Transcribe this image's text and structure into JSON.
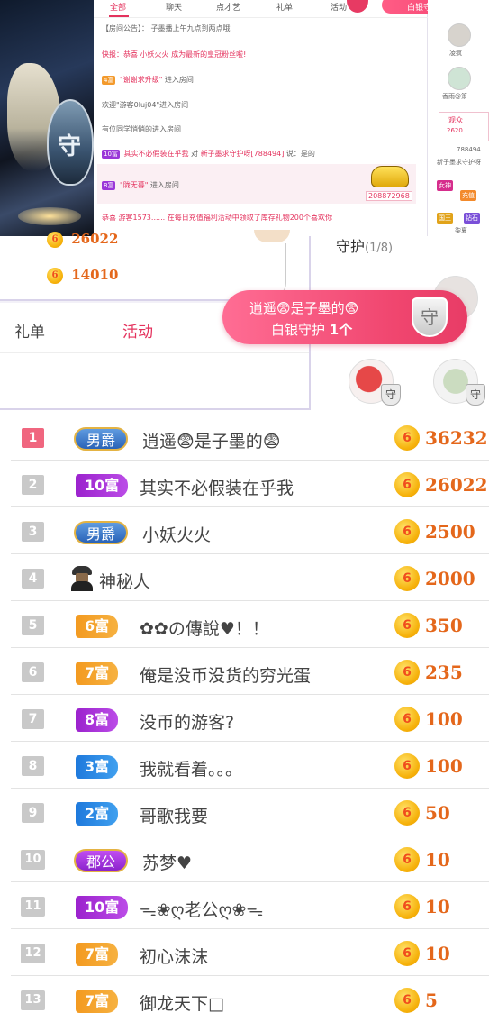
{
  "colors": {
    "accent": "#e4325d",
    "coin_text": "#e4671b",
    "guard_pink": "#f0466f"
  },
  "chat_window": {
    "tabs": [
      "全部",
      "聊天",
      "点才艺",
      "礼单",
      "活动"
    ],
    "guard_pill_label": "白银守护 1个",
    "messages": [
      {
        "prefix": "【房间公告】：",
        "text": "子墨播上午九点到两点哦"
      },
      {
        "prefix": "快报：恭喜",
        "text": "小妖火火 成为最新的皇冠粉丝啦!"
      },
      {
        "level": "4富",
        "name": "\"谢谢求升级\"",
        "text": "进入房间"
      },
      {
        "text": "欢迎\"游客0luj04\"进入房间"
      },
      {
        "text": "有位同学悄悄的进入房间"
      },
      {
        "level": "10富",
        "name": "其实不必假装在乎我",
        "mid": "对",
        "target": "新子墨求守护呀[788494]",
        "text": "说：是的"
      },
      {
        "level": "8富",
        "name": "\"陇无暮\"",
        "text": "进入房间"
      },
      {
        "text": "恭喜 游客1573...... 在每日充值福利活动中领取了库存礼物200个喜欢你"
      }
    ],
    "gift_number": "208872968"
  },
  "side_panel": {
    "users": [
      "凌疯",
      "香雨@箫"
    ],
    "tab_label": "观众",
    "tab_count": "2620",
    "viewer_id": "788494",
    "viewer_name": "新子墨求守护呀",
    "badges": [
      "女神",
      "充值",
      "国王",
      "钻石",
      "柒夏"
    ]
  },
  "mid_section": {
    "left_values": [
      "26022",
      "14010"
    ],
    "tabs": [
      "礼单",
      "活动"
    ],
    "guard_title": "守护",
    "guard_count": "(1/8)",
    "banner_line1": "逍遥😨是子墨的😨",
    "banner_line2_prefix": "白银守护 ",
    "banner_line2_count": "1个",
    "shield_glyph": "守"
  },
  "coin_glyph": "6",
  "ranking": [
    {
      "rank": "1",
      "badge": "男爵",
      "badge_type": "baron",
      "name": "逍遥😨是子墨的😨",
      "score": "36232"
    },
    {
      "rank": "2",
      "badge": "10富",
      "badge_type": "purple",
      "name": "其实不必假装在乎我",
      "score": "26022"
    },
    {
      "rank": "3",
      "badge": "男爵",
      "badge_type": "baron",
      "name": "小妖火火",
      "score": "2500"
    },
    {
      "rank": "4",
      "badge": "",
      "badge_type": "mystery",
      "name": "神秘人",
      "score": "2000"
    },
    {
      "rank": "5",
      "badge": "6富",
      "badge_type": "orange",
      "name": "✿✿の傳說♥！！",
      "score": "350"
    },
    {
      "rank": "6",
      "badge": "7富",
      "badge_type": "orange",
      "name": "俺是没币没货的穷光蛋",
      "score": "235"
    },
    {
      "rank": "7",
      "badge": "8富",
      "badge_type": "purple",
      "name": "没币的游客?",
      "score": "100"
    },
    {
      "rank": "8",
      "badge": "3富",
      "badge_type": "blue",
      "name": "我就看着。。。",
      "score": "100"
    },
    {
      "rank": "9",
      "badge": "2富",
      "badge_type": "blue",
      "name": "哥歌我要",
      "score": "50"
    },
    {
      "rank": "10",
      "badge": "郡公",
      "badge_type": "duke",
      "name": "苏梦♥",
      "score": "10"
    },
    {
      "rank": "11",
      "badge": "10富",
      "badge_type": "purple",
      "name": "ᯓ❀ღ老公ღ❀ᯓ",
      "score": "10"
    },
    {
      "rank": "12",
      "badge": "7富",
      "badge_type": "orange",
      "name": "初心沫沫",
      "score": "10"
    },
    {
      "rank": "13",
      "badge": "7富",
      "badge_type": "orange",
      "name": "御龙天下□",
      "score": "5"
    }
  ]
}
